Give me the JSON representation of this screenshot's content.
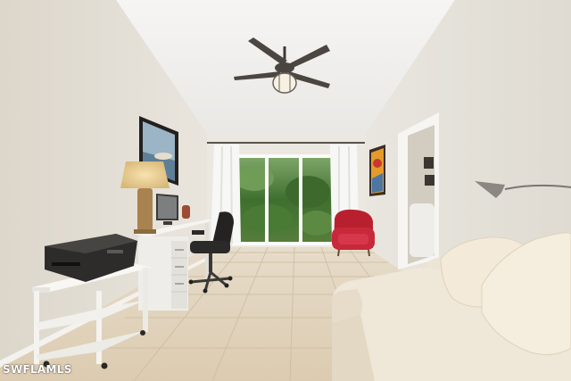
{
  "watermark": {
    "text": "SWFLAMLS"
  },
  "colors": {
    "wall_left": "#e4dfd5",
    "wall_right": "#e8e4dc",
    "ceiling": "#f3f2ef",
    "floor": "#e2d3bb",
    "grout": "#cdbd9f",
    "chair_red": "#c7283a",
    "sofa": "#ece4d4",
    "garden_green": "#4f7f3a"
  }
}
